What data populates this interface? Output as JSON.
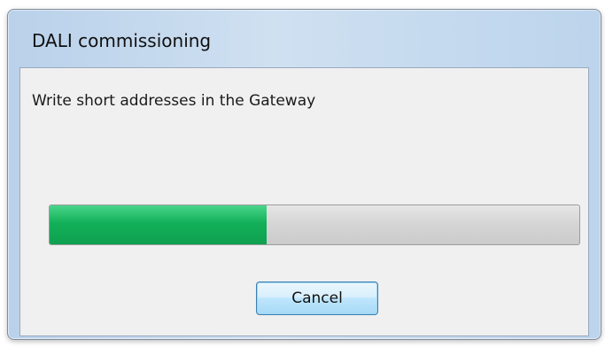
{
  "window": {
    "title": "DALI commissioning"
  },
  "dialog": {
    "message": "Write short addresses in the Gateway",
    "progress": {
      "fraction": 0.41
    }
  },
  "buttons": {
    "cancel_label": "Cancel"
  },
  "colors": {
    "progress_fill": "#12b058",
    "progress_track": "#d6d6d6",
    "title_bar": "#cfe0f1",
    "button_border": "#3c7fb1"
  }
}
